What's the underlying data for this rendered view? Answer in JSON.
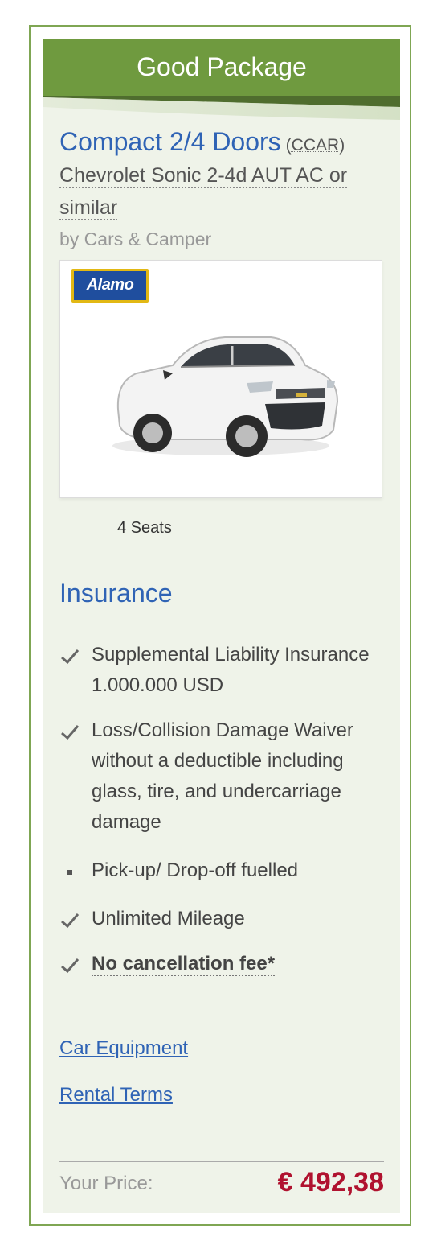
{
  "package": {
    "title": "Good Package",
    "category": "Compact 2/4 Doors",
    "code_open": "(",
    "code": "CCAR",
    "code_close": ")",
    "model": "Chevrolet Sonic 2-4d AUT AC or similar",
    "provider": "by Cars & Camper",
    "supplier_logo_text": "Alamo",
    "seats": "4 Seats"
  },
  "insurance": {
    "title": "Insurance",
    "items": [
      {
        "icon": "check-icon",
        "text": "Supplemental Liability Insurance 1.000.000 USD"
      },
      {
        "icon": "check-icon",
        "text": "Loss/Collision Damage Waiver without a deductible including glass, tire, and undercarriage damage"
      },
      {
        "icon": "bullet-icon",
        "text": "Pick-up/ Drop-off fuelled"
      },
      {
        "icon": "check-icon",
        "text": "Unlimited Mileage"
      },
      {
        "icon": "check-icon",
        "text": "No cancellation fee*"
      }
    ]
  },
  "links": {
    "car_equipment": "Car Equipment",
    "rental_terms": "Rental Terms"
  },
  "price": {
    "label": "Your Price:",
    "value": "€ 492,38"
  },
  "colors": {
    "header": "#6f9a3f",
    "accent_blue": "#2f63b5",
    "price_red": "#b0122f",
    "panel": "#eff3e9",
    "border": "#7fa653"
  }
}
